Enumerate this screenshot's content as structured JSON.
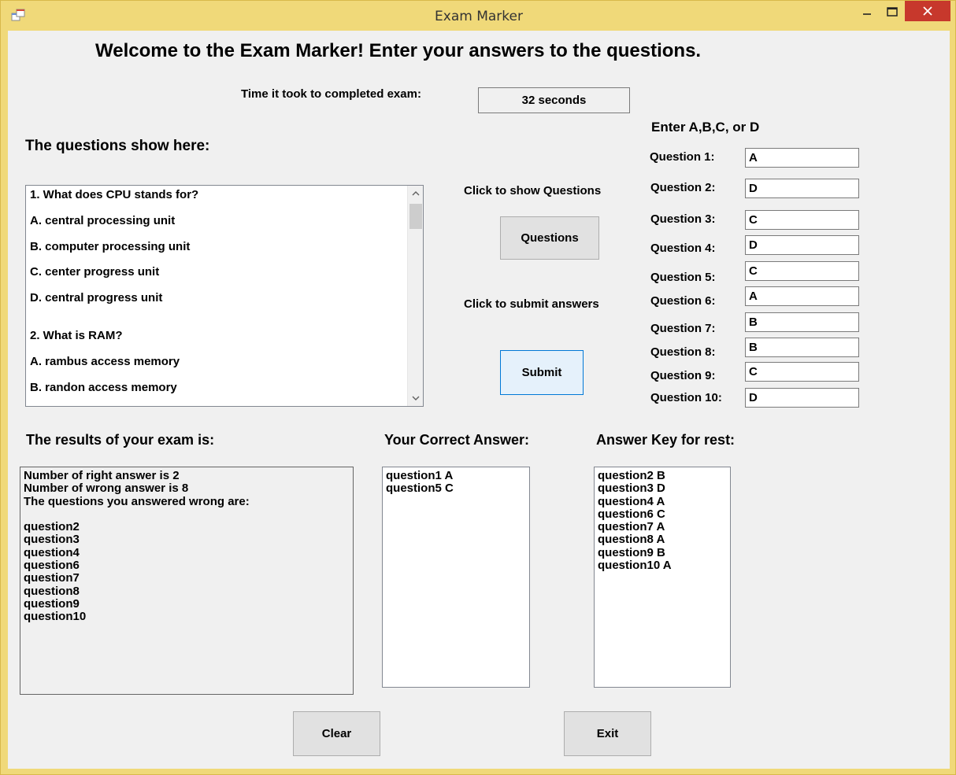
{
  "window": {
    "title": "Exam Marker",
    "controls": {
      "minimize": "—",
      "maximize": "☐",
      "close": "✕"
    }
  },
  "header": {
    "welcome": "Welcome to the Exam Marker! Enter your answers to the questions.",
    "time_label": "Time it took to completed exam:",
    "time_value": "32 seconds"
  },
  "questions_panel": {
    "label": "The questions show here:",
    "lines": [
      "1. What does CPU stands for?",
      "A. central processing unit",
      "B. computer processing unit",
      "C. center progress unit",
      "D. central progress unit",
      "2. What is RAM?",
      "A. rambus access memory",
      "B. randon access memory"
    ]
  },
  "actions": {
    "show_label": "Click to show Questions",
    "questions_button": "Questions",
    "submit_label": "Click to submit answers",
    "submit_button": "Submit",
    "clear_button": "Clear",
    "exit_button": "Exit"
  },
  "answers": {
    "heading": "Enter A,B,C, or D",
    "items": [
      {
        "label": "Question 1:",
        "value": "A"
      },
      {
        "label": "Question 2:",
        "value": "D"
      },
      {
        "label": "Question 3:",
        "value": "C"
      },
      {
        "label": "Question 4:",
        "value": "D"
      },
      {
        "label": "Question 5:",
        "value": "C"
      },
      {
        "label": "Question 6:",
        "value": "A"
      },
      {
        "label": "Question 7:",
        "value": "B"
      },
      {
        "label": "Question 8:",
        "value": "B"
      },
      {
        "label": "Question 9:",
        "value": "C"
      },
      {
        "label": "Question 10:",
        "value": "D"
      }
    ]
  },
  "results": {
    "label": "The results of your exam is:",
    "lines": [
      "Number of right answer is 2",
      "Number of wrong answer is 8",
      "The questions you answered wrong are:",
      "",
      "question2",
      "question3",
      "question4",
      "question6",
      "question7",
      "question8",
      "question9",
      "question10"
    ]
  },
  "correct": {
    "label": "Your Correct Answer:",
    "lines": [
      "question1 A",
      "question5 C"
    ]
  },
  "answer_key": {
    "label": "Answer Key for rest:",
    "lines": [
      "question2 B",
      "question3 D",
      "question4 A",
      "question6 C",
      "question7 A",
      "question8 A",
      "question9 B",
      "question10 A"
    ]
  }
}
